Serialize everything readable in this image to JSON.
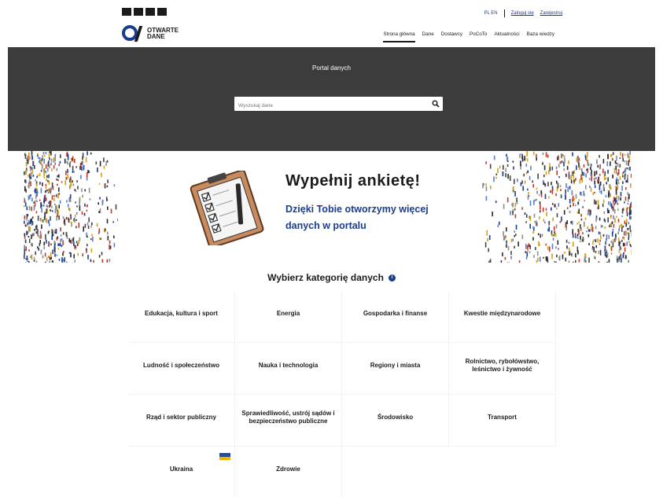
{
  "header": {
    "gov_label": "",
    "lang": "PL EN",
    "login_label": "Zaloguj się",
    "register_label": "Zarejestruj"
  },
  "brand": {
    "name_line1": "OTWARTE",
    "name_line2": "DANE"
  },
  "nav": {
    "items": [
      {
        "label": "Strona główna",
        "active": true
      },
      {
        "label": "Dane"
      },
      {
        "label": "Dostawcy"
      },
      {
        "label": "PoCoTo"
      },
      {
        "label": "Aktualności"
      },
      {
        "label": "Baza wiedzy"
      }
    ]
  },
  "hero": {
    "title": "Portal danych",
    "subtitle": "",
    "search_placeholder": "Wyszukaj dane"
  },
  "banner": {
    "title": "Wypełnij ankietę!",
    "subtitle": "Dzięki Tobie otworzymy więcej danych w portalu"
  },
  "categories": {
    "heading": "Wybierz kategorię danych",
    "items": [
      {
        "name": "Edukacja, kultura i sport",
        "count": ""
      },
      {
        "name": "Energia",
        "count": ""
      },
      {
        "name": "Gospodarka i finanse",
        "count": ""
      },
      {
        "name": "Kwestie międzynarodowe",
        "count": ""
      },
      {
        "name": "Ludność i społeczeństwo",
        "count": ""
      },
      {
        "name": "Nauka i technologia",
        "count": ""
      },
      {
        "name": "Regiony i miasta",
        "count": ""
      },
      {
        "name": "Rolnictwo, rybołówstwo, leśnictwo i żywność",
        "count": ""
      },
      {
        "name": "Rząd i sektor publiczny",
        "count": ""
      },
      {
        "name": "Sprawiedliwość, ustrój sądów i bezpieczeństwo publiczne",
        "count": ""
      },
      {
        "name": "Środowisko",
        "count": ""
      },
      {
        "name": "Transport",
        "count": ""
      },
      {
        "name": "Ukraina",
        "count": ""
      },
      {
        "name": "Zdrowie",
        "count": ""
      }
    ]
  },
  "colors": {
    "accent": "#1b3d8f",
    "hero_bg": "#3c3c3c"
  }
}
